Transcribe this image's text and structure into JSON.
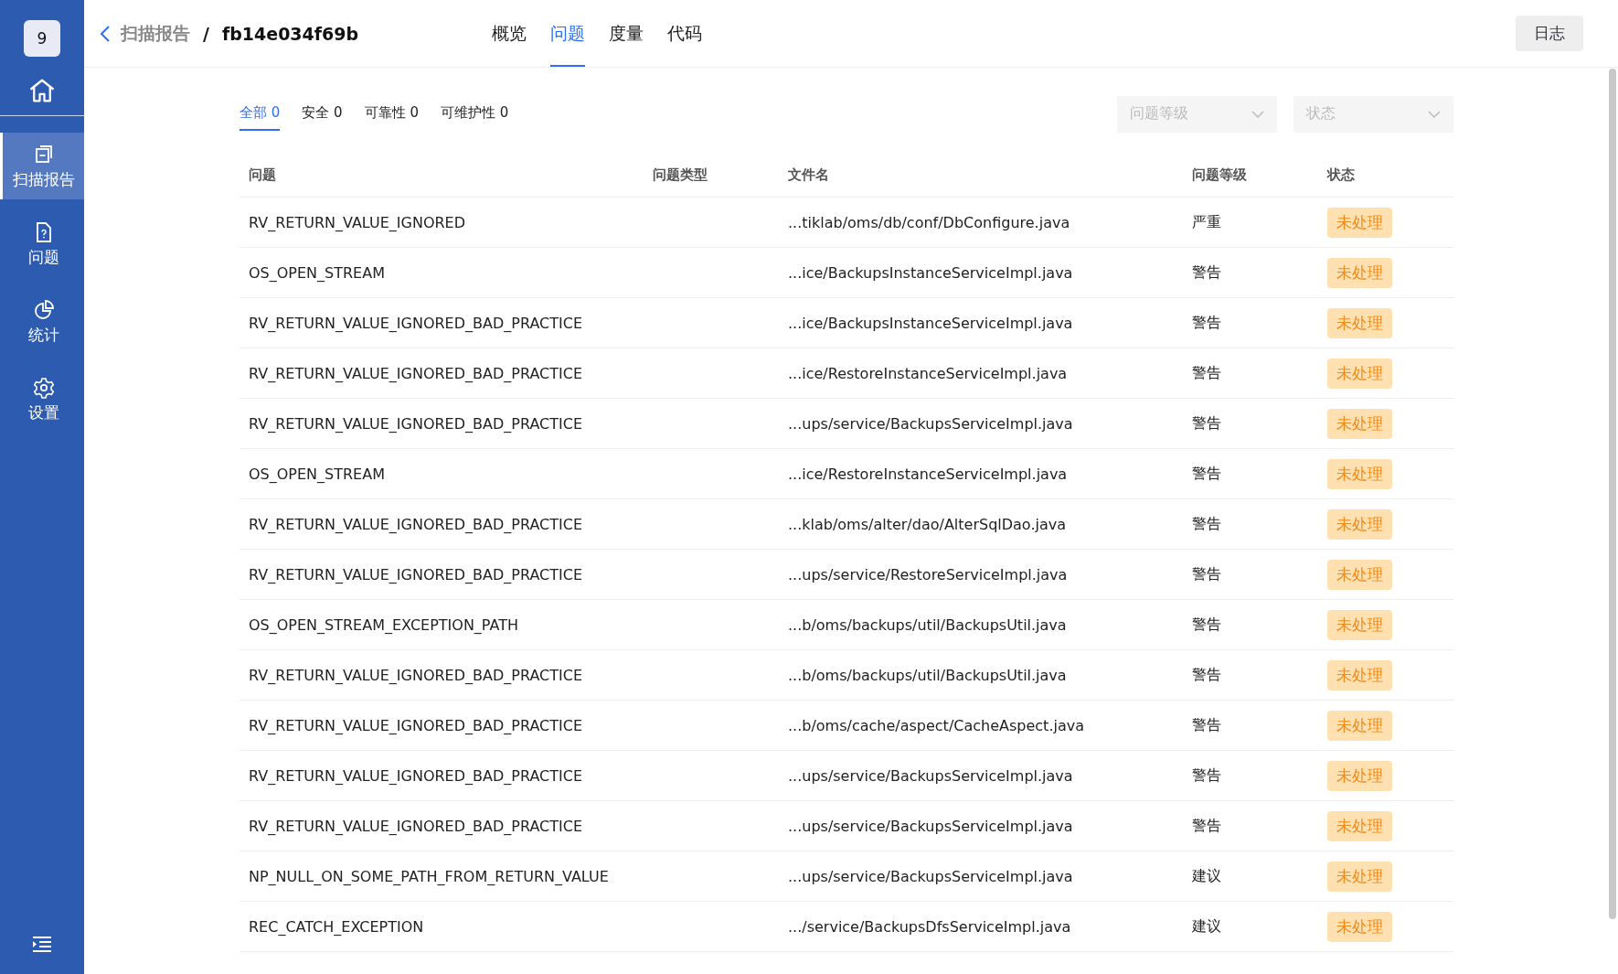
{
  "sidebar": {
    "badge": "9",
    "items": [
      {
        "kind": "report",
        "label": "扫描报告",
        "selected": true
      },
      {
        "kind": "issue",
        "label": "问题",
        "selected": false
      },
      {
        "kind": "stats",
        "label": "统计",
        "selected": false
      },
      {
        "kind": "settings",
        "label": "设置",
        "selected": false
      }
    ]
  },
  "header": {
    "breadcrumb_parent": "扫描报告",
    "separator": "/",
    "breadcrumb_current": "fb14e034f69b",
    "tabs": [
      {
        "label": "概览",
        "selected": false
      },
      {
        "label": "问题",
        "selected": true
      },
      {
        "label": "度量",
        "selected": false
      },
      {
        "label": "代码",
        "selected": false
      }
    ],
    "log_button": "日志"
  },
  "categories": [
    {
      "label": "全部",
      "count": "0",
      "selected": true
    },
    {
      "label": "安全",
      "count": "0",
      "selected": false
    },
    {
      "label": "可靠性",
      "count": "0",
      "selected": false
    },
    {
      "label": "可维护性",
      "count": "0",
      "selected": false
    }
  ],
  "filters": [
    {
      "placeholder": "问题等级"
    },
    {
      "placeholder": "状态"
    }
  ],
  "table": {
    "columns": [
      "问题",
      "问题类型",
      "文件名",
      "问题等级",
      "状态"
    ],
    "rows": [
      {
        "issue": "RV_RETURN_VALUE_IGNORED",
        "file": "...tiklab/oms/db/conf/DbConfigure.java",
        "level": "严重",
        "status": "未处理"
      },
      {
        "issue": "OS_OPEN_STREAM",
        "file": "...ice/BackupsInstanceServiceImpl.java",
        "level": "警告",
        "status": "未处理"
      },
      {
        "issue": "RV_RETURN_VALUE_IGNORED_BAD_PRACTICE",
        "file": "...ice/BackupsInstanceServiceImpl.java",
        "level": "警告",
        "status": "未处理"
      },
      {
        "issue": "RV_RETURN_VALUE_IGNORED_BAD_PRACTICE",
        "file": "...ice/RestoreInstanceServiceImpl.java",
        "level": "警告",
        "status": "未处理"
      },
      {
        "issue": "RV_RETURN_VALUE_IGNORED_BAD_PRACTICE",
        "file": "...ups/service/BackupsServiceImpl.java",
        "level": "警告",
        "status": "未处理"
      },
      {
        "issue": "OS_OPEN_STREAM",
        "file": "...ice/RestoreInstanceServiceImpl.java",
        "level": "警告",
        "status": "未处理"
      },
      {
        "issue": "RV_RETURN_VALUE_IGNORED_BAD_PRACTICE",
        "file": "...klab/oms/alter/dao/AlterSqlDao.java",
        "level": "警告",
        "status": "未处理"
      },
      {
        "issue": "RV_RETURN_VALUE_IGNORED_BAD_PRACTICE",
        "file": "...ups/service/RestoreServiceImpl.java",
        "level": "警告",
        "status": "未处理"
      },
      {
        "issue": "OS_OPEN_STREAM_EXCEPTION_PATH",
        "file": "...b/oms/backups/util/BackupsUtil.java",
        "level": "警告",
        "status": "未处理"
      },
      {
        "issue": "RV_RETURN_VALUE_IGNORED_BAD_PRACTICE",
        "file": "...b/oms/backups/util/BackupsUtil.java",
        "level": "警告",
        "status": "未处理"
      },
      {
        "issue": "RV_RETURN_VALUE_IGNORED_BAD_PRACTICE",
        "file": "...b/oms/cache/aspect/CacheAspect.java",
        "level": "警告",
        "status": "未处理"
      },
      {
        "issue": "RV_RETURN_VALUE_IGNORED_BAD_PRACTICE",
        "file": "...ups/service/BackupsServiceImpl.java",
        "level": "警告",
        "status": "未处理"
      },
      {
        "issue": "RV_RETURN_VALUE_IGNORED_BAD_PRACTICE",
        "file": "...ups/service/BackupsServiceImpl.java",
        "level": "警告",
        "status": "未处理"
      },
      {
        "issue": "NP_NULL_ON_SOME_PATH_FROM_RETURN_VALUE",
        "file": "...ups/service/BackupsServiceImpl.java",
        "level": "建议",
        "status": "未处理"
      },
      {
        "issue": "REC_CATCH_EXCEPTION",
        "file": ".../service/BackupsDfsServiceImpl.java",
        "level": "建议",
        "status": "未处理"
      }
    ]
  }
}
